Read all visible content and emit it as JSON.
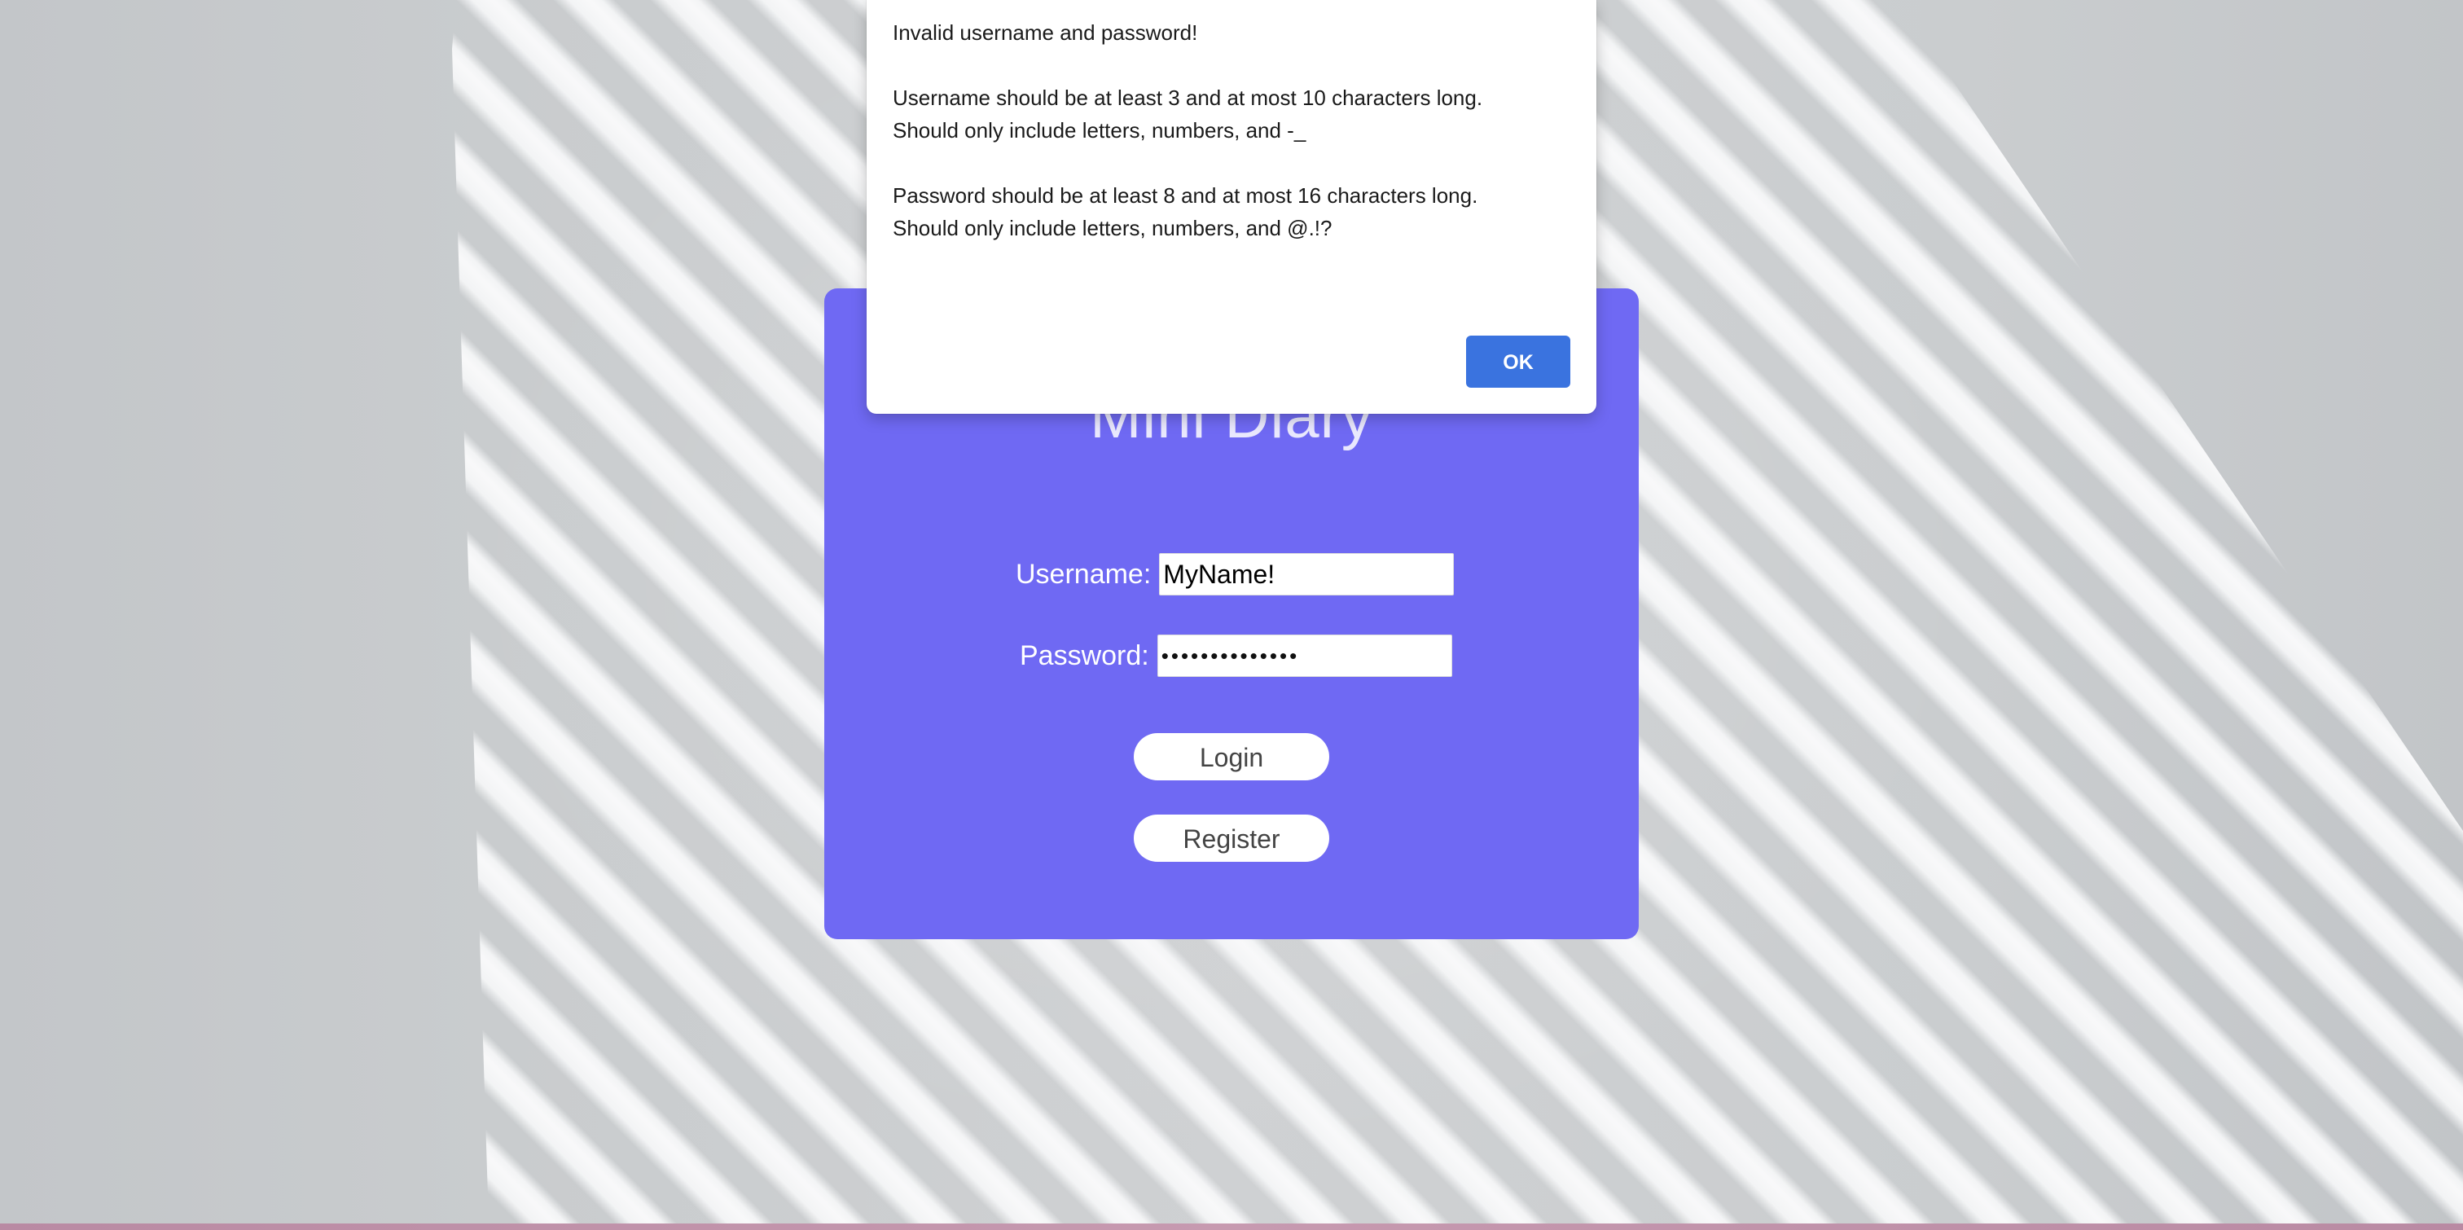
{
  "app": {
    "title": "Mini Diary"
  },
  "login_form": {
    "username_label": "Username:",
    "username_value": "MyName!",
    "password_label": "Password:",
    "password_masked": "••••••••••••••",
    "login_button": "Login",
    "register_button": "Register"
  },
  "alert_dialog": {
    "heading": "Invalid username and password!",
    "username_rule_1": "Username should be at least 3 and at most 10 characters long.",
    "username_rule_2": "Should only include letters, numbers, and -_",
    "password_rule_1": "Password should be at least 8 and at most 16 characters long.",
    "password_rule_2": "Should only include letters, numbers, and @.!?",
    "ok_button": "OK"
  },
  "colors": {
    "card_background": "#6f69f3",
    "ok_button": "#3a73df",
    "title_text": "#e9e8fd"
  }
}
